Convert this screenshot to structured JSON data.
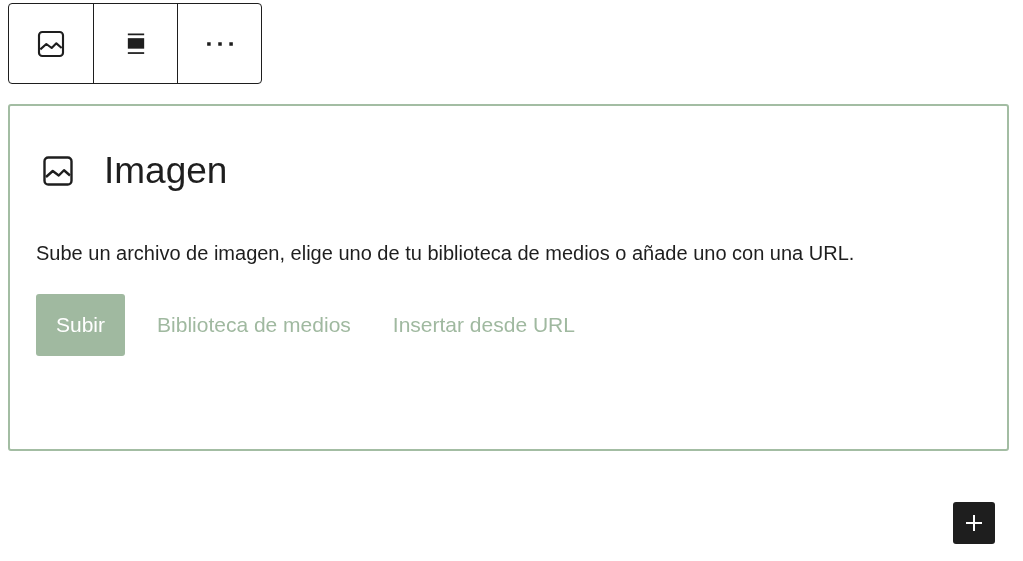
{
  "toolbar": [
    {
      "kind": "image"
    },
    {
      "kind": "align"
    },
    {
      "kind": "more"
    }
  ],
  "block": {
    "title": "Imagen",
    "description": "Sube un archivo de imagen, elige uno de tu biblioteca de medios o añade uno con una URL.",
    "actions": [
      {
        "label": "Subir",
        "kind": "primary"
      },
      {
        "label": "Biblioteca de medios",
        "kind": "link"
      },
      {
        "label": "Insertar desde URL",
        "kind": "link"
      }
    ]
  }
}
